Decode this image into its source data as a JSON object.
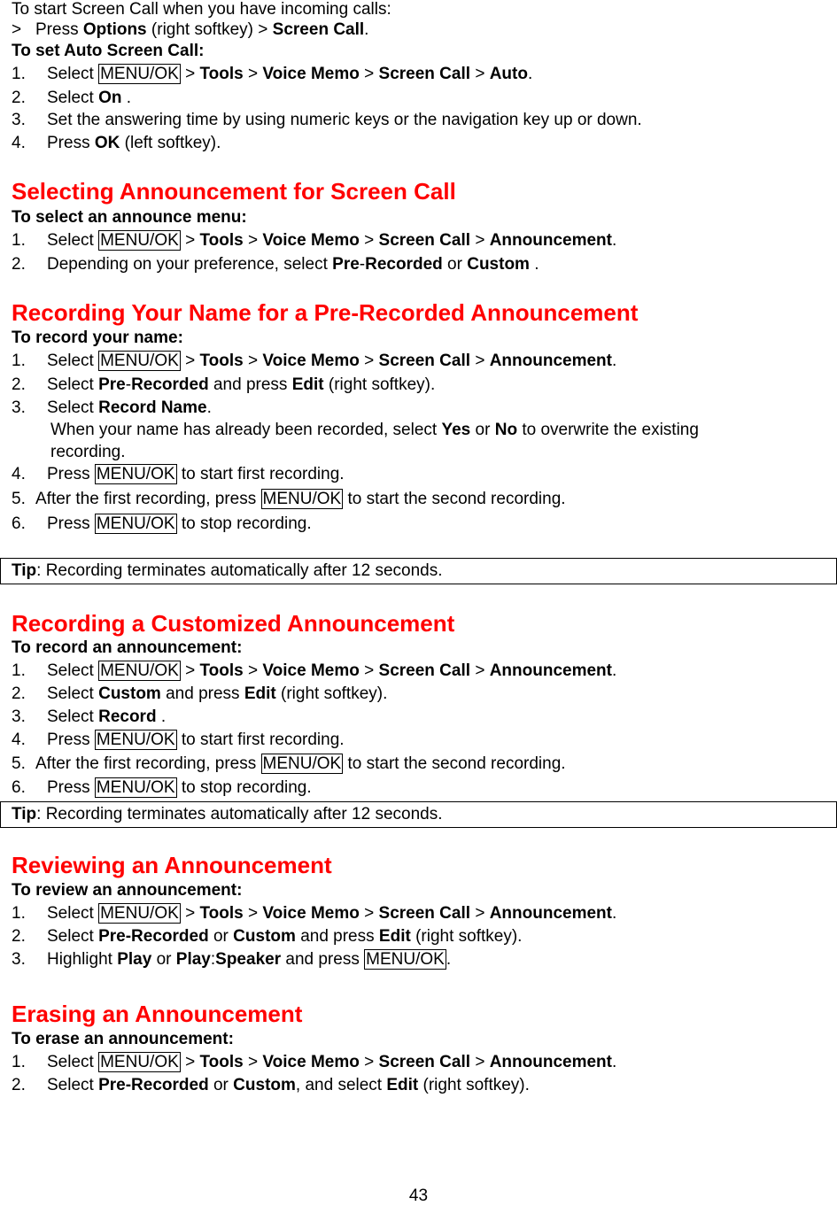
{
  "intro": {
    "line1": "To start Screen Call when you have incoming calls:",
    "line2": {
      "prefix": ">",
      "press": "Press",
      "options": "Options",
      "mid": "(right softkey) >",
      "screen_call": "Screen Call",
      "end": "."
    },
    "auto_heading": "To set Auto Screen Call:",
    "auto_steps": {
      "s1": {
        "num": "1.",
        "select": "Select",
        "key": "MENU/OK",
        "gt": ">",
        "tools": "Tools",
        "voice_memo": "Voice Memo",
        "screen_call": "Screen Call",
        "last": "Auto",
        "end": "."
      },
      "s2": {
        "num": "2.",
        "select": "Select",
        "on": "On",
        "end": " ."
      },
      "s3": {
        "num": "3.",
        "text": "Set the answering time by using numeric keys or the navigation key up or down."
      },
      "s4": {
        "num": "4.",
        "press": "Press",
        "ok": "OK",
        "end": "(left softkey)."
      }
    }
  },
  "sections": {
    "selecting": {
      "title": "Selecting Announcement for Screen Call",
      "subheading": "To select an announce menu:",
      "s1": {
        "num": "1.",
        "select": "Select",
        "key": "MENU/OK",
        "gt": ">",
        "tools": "Tools",
        "voice_memo": "Voice Memo",
        "screen_call": "Screen Call",
        "last": "Announcement",
        "end": "."
      },
      "s2": {
        "num": "2.",
        "text": "Depending on your preference, select",
        "pre": "Pre",
        "dash": "-",
        "recorded": "Recorded",
        "or": "or",
        "custom": "Custom",
        "end": " ."
      }
    },
    "recording_name": {
      "title": "Recording Your Name for a Pre-Recorded Announcement",
      "subheading": "To record your name:",
      "s1": {
        "num": "1.",
        "select": "Select",
        "key": "MENU/OK",
        "gt": ">",
        "tools": "Tools",
        "voice_memo": "Voice Memo",
        "screen_call": "Screen Call",
        "last": "Announcement",
        "end": "."
      },
      "s2": {
        "num": "2.",
        "select": "Select",
        "pre": "Pre",
        "dash": "-",
        "recorded": "Recorded",
        "mid": "and press",
        "edit": "Edit",
        "end": "(right softkey)."
      },
      "s3": {
        "num": "3.",
        "select": "Select",
        "record_name": "Record Name",
        "end": "."
      },
      "s3_note": {
        "a": "When your name has already been recorded, select",
        "yes": "Yes",
        "or": "or",
        "no": "No",
        "b": "to overwrite the existing",
        "c": "recording."
      },
      "s4": {
        "num": "4.",
        "press": "Press",
        "key": "MENU/OK",
        "end": "to start first recording."
      },
      "s5": {
        "num": "5.",
        "text": "After the first recording, press",
        "key": "MENU/OK",
        "end": "to start the second recording."
      },
      "s6": {
        "num": "6.",
        "press": "Press",
        "key": "MENU/OK",
        "end": "to stop recording."
      },
      "tip": {
        "label": "Tip",
        "text": ": Recording terminates automatically after 12 seconds."
      }
    },
    "customized": {
      "title": "Recording a Customized Announcement",
      "subheading": "To record an announcement:",
      "s1": {
        "num": "1.",
        "select": "Select",
        "key": "MENU/OK",
        "gt": ">",
        "tools": "Tools",
        "voice_memo": "Voice Memo",
        "screen_call": "Screen Call",
        "last": "Announcement",
        "end": "."
      },
      "s2": {
        "num": "2.",
        "select": "Select",
        "custom": "Custom",
        "mid": "and press",
        "edit": "Edit",
        "end": "(right softkey)."
      },
      "s3": {
        "num": "3.",
        "select": "Select",
        "record": "Record",
        "end": " ."
      },
      "s4": {
        "num": "4.",
        "press": "Press",
        "key": "MENU/OK",
        "end": "to start first recording."
      },
      "s5": {
        "num": "5.",
        "text": "After the first recording, press",
        "key": "MENU/OK",
        "end": "to start the second recording."
      },
      "s6": {
        "num": "6.",
        "press": "Press",
        "key": "MENU/OK",
        "end": "to stop recording."
      },
      "tip": {
        "label": "Tip",
        "text": ": Recording terminates automatically after 12 seconds."
      }
    },
    "reviewing": {
      "title": "Reviewing an Announcement",
      "subheading": "To review an announcement:",
      "s1": {
        "num": "1.",
        "select": "Select",
        "key": "MENU/OK",
        "gt": ">",
        "tools": "Tools",
        "voice_memo": "Voice Memo",
        "screen_call": "Screen Call",
        "last": "Announcement",
        "end": "."
      },
      "s2": {
        "num": "2.",
        "select": "Select",
        "pre_recorded": "Pre-Recorded",
        "or": "or",
        "custom": "Custom",
        "mid": "and press",
        "edit": "Edit",
        "end": "(right softkey)."
      },
      "s3": {
        "num": "3.",
        "highlight": "Highlight",
        "play": "Play",
        "or": "or",
        "play2": "Play",
        "colon": ":",
        "speaker": "Speaker",
        "mid": "and press",
        "key": "MENU/OK",
        "end": "."
      }
    },
    "erasing": {
      "title": "Erasing an Announcement",
      "subheading": "To erase an announcement:",
      "s1": {
        "num": "1.",
        "select": "Select",
        "key": "MENU/OK",
        "gt": ">",
        "tools": "Tools",
        "voice_memo": "Voice Memo",
        "screen_call": "Screen Call",
        "last": "Announcement",
        "end": "."
      },
      "s2": {
        "num": "2.",
        "select": "Select",
        "pre_recorded": "Pre-Recorded",
        "or": "or",
        "custom": "Custom",
        "mid": ", and select",
        "edit": "Edit",
        "end": "(right softkey)."
      }
    }
  },
  "page_number": "43"
}
